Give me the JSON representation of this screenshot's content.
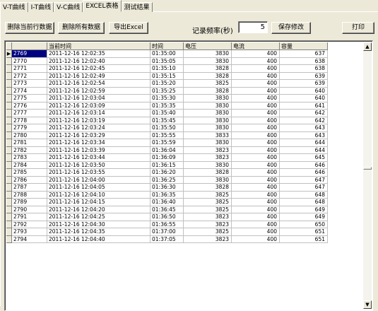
{
  "tabs": [
    {
      "label": "V-T曲线",
      "active": false
    },
    {
      "label": "I-T曲线",
      "active": false
    },
    {
      "label": "V-C曲线",
      "active": false
    },
    {
      "label": "EXCEL表格",
      "active": true
    },
    {
      "label": "测试结果",
      "active": false
    }
  ],
  "toolbar": {
    "delete_row_label": "删除当前行数据",
    "delete_all_label": "删除所有数据",
    "export_label": "导出Excel",
    "freq_label": "记录频率(秒)",
    "freq_value": "5",
    "save_label": "保存修改",
    "print_label": "打印"
  },
  "table": {
    "current_row_marker": "▶",
    "columns": [
      "",
      "当前时间",
      "时间",
      "电压",
      "电流",
      "容量"
    ],
    "rows": [
      [
        "2769",
        "2011-12-16 12:02:35",
        "01:35:00",
        "3830",
        "400",
        "637"
      ],
      [
        "2770",
        "2011-12-16 12:02:40",
        "01:35:05",
        "3830",
        "400",
        "638"
      ],
      [
        "2771",
        "2011-12-16 12:02:45",
        "01:35:10",
        "3828",
        "400",
        "638"
      ],
      [
        "2772",
        "2011-12-16 12:02:49",
        "01:35:15",
        "3828",
        "400",
        "639"
      ],
      [
        "2773",
        "2011-12-16 12:02:54",
        "01:35:20",
        "3825",
        "400",
        "639"
      ],
      [
        "2774",
        "2011-12-16 12:02:59",
        "01:35:25",
        "3828",
        "400",
        "640"
      ],
      [
        "2775",
        "2011-12-16 12:03:04",
        "01:35:30",
        "3830",
        "400",
        "640"
      ],
      [
        "2776",
        "2011-12-16 12:03:09",
        "01:35:35",
        "3830",
        "400",
        "641"
      ],
      [
        "2777",
        "2011-12-16 12:03:14",
        "01:35:40",
        "3830",
        "400",
        "642"
      ],
      [
        "2778",
        "2011-12-16 12:03:19",
        "01:35:45",
        "3830",
        "400",
        "642"
      ],
      [
        "2779",
        "2011-12-16 12:03:24",
        "01:35:50",
        "3830",
        "400",
        "643"
      ],
      [
        "2780",
        "2011-12-16 12:03:29",
        "01:35:55",
        "3833",
        "400",
        "643"
      ],
      [
        "2781",
        "2011-12-16 12:03:34",
        "01:35:59",
        "3830",
        "400",
        "644"
      ],
      [
        "2782",
        "2011-12-16 12:03:39",
        "01:36:04",
        "3823",
        "400",
        "644"
      ],
      [
        "2783",
        "2011-12-16 12:03:44",
        "01:36:09",
        "3823",
        "400",
        "645"
      ],
      [
        "2784",
        "2011-12-16 12:03:50",
        "01:36:15",
        "3830",
        "400",
        "646"
      ],
      [
        "2785",
        "2011-12-16 12:03:55",
        "01:36:20",
        "3828",
        "400",
        "646"
      ],
      [
        "2786",
        "2011-12-16 12:04:00",
        "01:36:25",
        "3830",
        "400",
        "647"
      ],
      [
        "2787",
        "2011-12-16 12:04:05",
        "01:36:30",
        "3828",
        "400",
        "647"
      ],
      [
        "2788",
        "2011-12-16 12:04:10",
        "01:36:35",
        "3825",
        "400",
        "648"
      ],
      [
        "2789",
        "2011-12-16 12:04:15",
        "01:36:40",
        "3825",
        "400",
        "648"
      ],
      [
        "2790",
        "2011-12-16 12:04:20",
        "01:36:45",
        "3825",
        "400",
        "649"
      ],
      [
        "2791",
        "2011-12-16 12:04:25",
        "01:36:50",
        "3823",
        "400",
        "649"
      ],
      [
        "2792",
        "2011-12-16 12:04:30",
        "01:36:55",
        "3823",
        "400",
        "650"
      ],
      [
        "2793",
        "2011-12-16 12:04:35",
        "01:37:00",
        "3825",
        "400",
        "651"
      ],
      [
        "2794",
        "2011-12-16 12:04:40",
        "01:37:05",
        "3823",
        "400",
        "651"
      ]
    ]
  },
  "scrollbar": {
    "up_icon": "scroll-up-arrow-icon",
    "down_icon": "scroll-down-arrow-icon"
  },
  "colors": {
    "face": "#ece9d8",
    "selection": "#000080",
    "grid_line": "#c0c0c0"
  }
}
